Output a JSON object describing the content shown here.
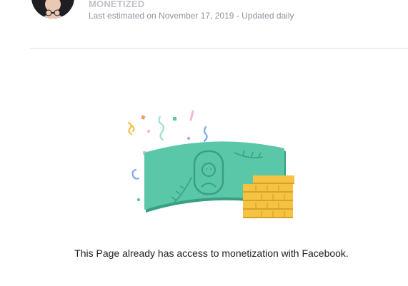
{
  "status": {
    "title": "MONETIZED",
    "subtitle": "Last estimated on November 17, 2019 - Updated daily"
  },
  "main": {
    "message": "This Page already has access to monetization with Facebook."
  },
  "icons": {
    "avatar": "profile-avatar",
    "illustration": "money-bill-and-coins-confetti"
  },
  "colors": {
    "bill": "#5ac8a8",
    "bill_dark": "#3a9f82",
    "coins": "#f5c242",
    "coins_dark": "#d9a12a",
    "muted_text": "#90949c",
    "title_text": "#bec3c9"
  }
}
